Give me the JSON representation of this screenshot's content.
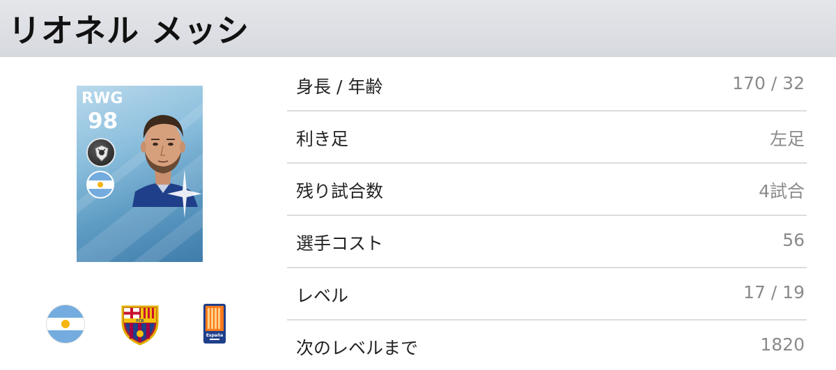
{
  "player": {
    "name": "リオネル メッシ",
    "position": "RWG",
    "rating": "98"
  },
  "details": [
    {
      "label": "身長 / 年齢",
      "value": "170 / 32"
    },
    {
      "label": "利き足",
      "value": "左足"
    },
    {
      "label": "残り試合数",
      "value": "4試合"
    },
    {
      "label": "選手コスト",
      "value": "56"
    },
    {
      "label": "レベル",
      "value": "17 / 19"
    },
    {
      "label": "次のレベルまで",
      "value": "1820"
    }
  ],
  "icons": {
    "nationality": "argentina-flag-icon",
    "club": "fc-barcelona-crest-icon",
    "league": "laliga-espana-icon",
    "card_badge": "player-skill-badge-icon"
  },
  "colors": {
    "header_bg": "#d9dce1",
    "card_blue": "#5f9cc4",
    "value_gray": "#8a8a8a",
    "divider": "#dcdcdc"
  },
  "league_badge": {
    "text": "España"
  }
}
